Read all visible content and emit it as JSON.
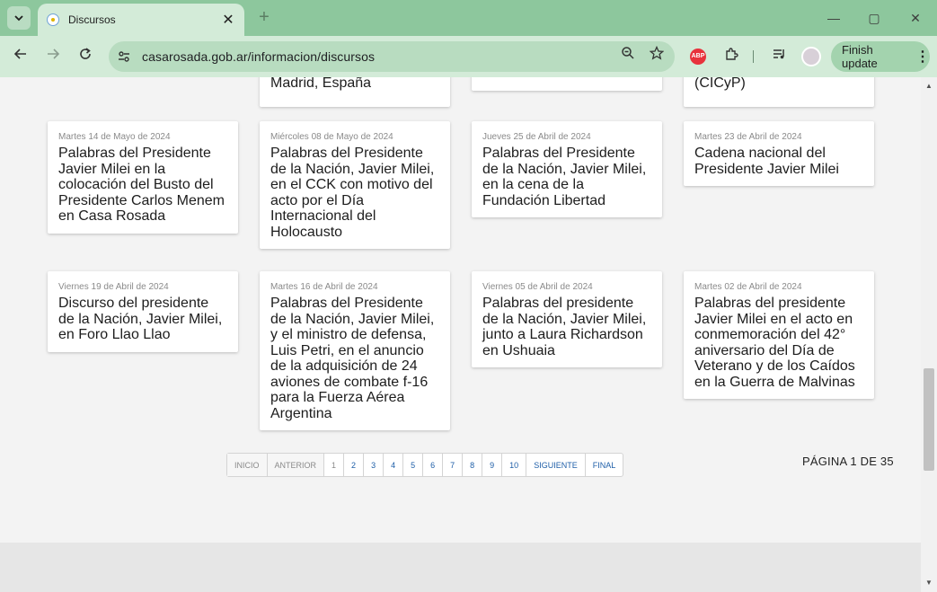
{
  "browser": {
    "tab_title": "Discursos",
    "tab_close": "✕",
    "new_tab": "+",
    "url": "casarosada.gob.ar/informacion/discursos",
    "finish_update": "Finish update",
    "abp_label": "ABP",
    "window_controls": {
      "minimize": "—",
      "maximize": "▢",
      "close": "✕"
    }
  },
  "cards_top_partial": [
    {
      "title_tail": "Madrid, España"
    },
    {
      "title_tail": ""
    },
    {
      "title_tail": "(CICyP)"
    }
  ],
  "cards_row1": [
    {
      "date": "Martes 14 de Mayo de 2024",
      "title": "Palabras del Presidente Javier Milei en la colocación del Busto del Presidente Carlos Menem en Casa Rosada"
    },
    {
      "date": "Miércoles 08 de Mayo de 2024",
      "title": "Palabras del Presidente de la Nación, Javier Milei, en el CCK con motivo del acto por el Día Internacional del Holocausto"
    },
    {
      "date": "Jueves 25 de Abril de 2024",
      "title": "Palabras del Presidente de la Nación, Javier Milei, en la cena de la Fundación Libertad"
    },
    {
      "date": "Martes 23 de Abril de 2024",
      "title": "Cadena nacional del Presidente Javier Milei"
    }
  ],
  "cards_row2": [
    {
      "date": "Viernes 19 de Abril de 2024",
      "title": "Discurso del presidente de la Nación, Javier Milei, en Foro Llao Llao"
    },
    {
      "date": "Martes 16 de Abril de 2024",
      "title": "Palabras del Presidente de la Nación, Javier Milei, y el ministro de defensa, Luis Petri, en el anuncio de la adquisición de 24 aviones de combate f-16 para la Fuerza Aérea Argentina"
    },
    {
      "date": "Viernes 05 de Abril de 2024",
      "title": "Palabras del presidente de la Nación, Javier Milei, junto a Laura Richardson en Ushuaia"
    },
    {
      "date": "Martes 02 de Abril de 2024",
      "title": "Palabras del presidente Javier Milei en el acto en conmemoración del 42° aniversario del Día de Veterano y de los Caídos en la Guerra de Malvinas"
    }
  ],
  "pagination": {
    "first": "INICIO",
    "prev": "ANTERIOR",
    "pages": [
      "1",
      "2",
      "3",
      "4",
      "5",
      "6",
      "7",
      "8",
      "9",
      "10"
    ],
    "next": "SIGUIENTE",
    "last": "FINAL",
    "current_page": 1,
    "indicator": "PÁGINA 1 DE 35"
  }
}
